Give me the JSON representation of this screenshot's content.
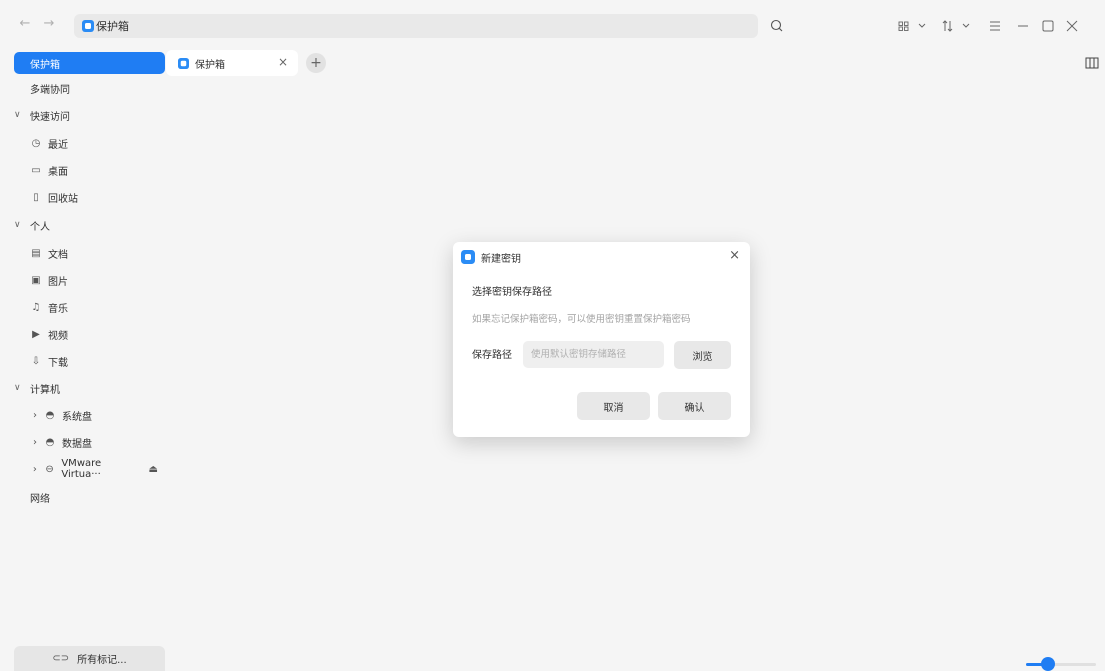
{
  "window": {
    "address_text": "保护箱",
    "accent_color": "#1f7df3"
  },
  "sidebar": {
    "items": [
      {
        "label": "保护箱",
        "active": true
      },
      {
        "label": "多端协同"
      }
    ],
    "quick_access": {
      "label": "快速访问",
      "items": [
        {
          "label": "最近",
          "icon": "clock-icon"
        },
        {
          "label": "桌面",
          "icon": "desktop-icon"
        },
        {
          "label": "回收站",
          "icon": "trash-icon"
        }
      ]
    },
    "personal": {
      "label": "个人",
      "items": [
        {
          "label": "文档",
          "icon": "document-icon"
        },
        {
          "label": "图片",
          "icon": "picture-icon"
        },
        {
          "label": "音乐",
          "icon": "music-icon"
        },
        {
          "label": "视频",
          "icon": "video-icon"
        },
        {
          "label": "下载",
          "icon": "download-icon"
        }
      ]
    },
    "computer": {
      "label": "计算机",
      "items": [
        {
          "label": "系统盘",
          "icon": "disk-icon"
        },
        {
          "label": "数据盘",
          "icon": "disk-icon"
        },
        {
          "label": "VMware Virtua···",
          "icon": "drive-icon"
        }
      ]
    },
    "network_label": "网络",
    "tags_button": "所有标记..."
  },
  "tabs": [
    {
      "label": "保护箱"
    }
  ],
  "dialog": {
    "title": "新建密钥",
    "heading": "选择密钥保存路径",
    "description": "如果忘记保护箱密码，可以使用密钥重置保护箱密码",
    "path_label": "保存路径",
    "path_placeholder": "使用默认密钥存储路径",
    "browse_label": "浏览",
    "cancel_label": "取消",
    "confirm_label": "确认"
  },
  "zoom_slider": {
    "value": 0.3
  }
}
